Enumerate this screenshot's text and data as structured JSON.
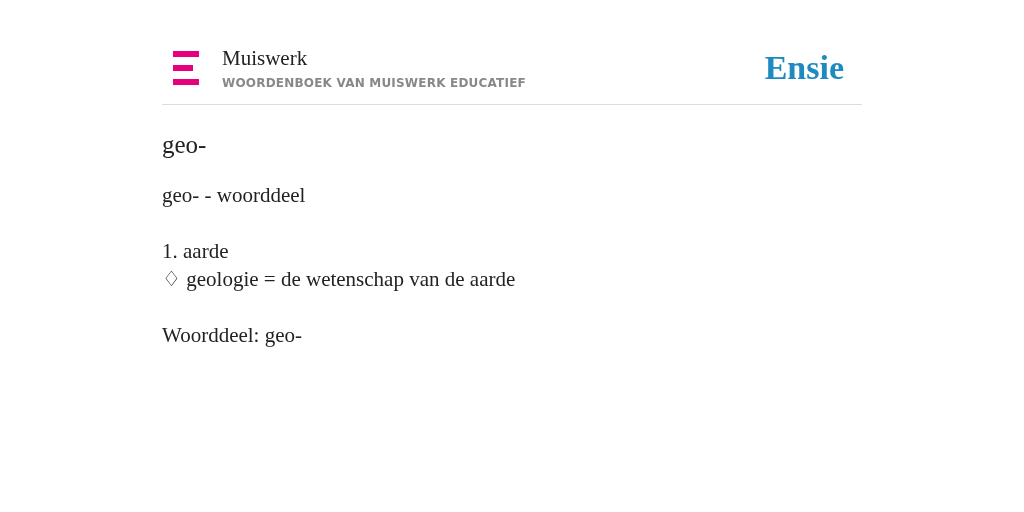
{
  "header": {
    "publisher": "Muiswerk",
    "subtitle": "WOORDENBOEK VAN MUISWERK EDUCATIEF",
    "brand": "Ensie"
  },
  "entry": {
    "title": "geo-",
    "paragraphs": [
      [
        "geo- - woorddeel"
      ],
      [
        "1. aarde",
        "♢ geologie = de wetenschap van de aarde"
      ],
      [
        "Woorddeel: geo-"
      ]
    ]
  }
}
